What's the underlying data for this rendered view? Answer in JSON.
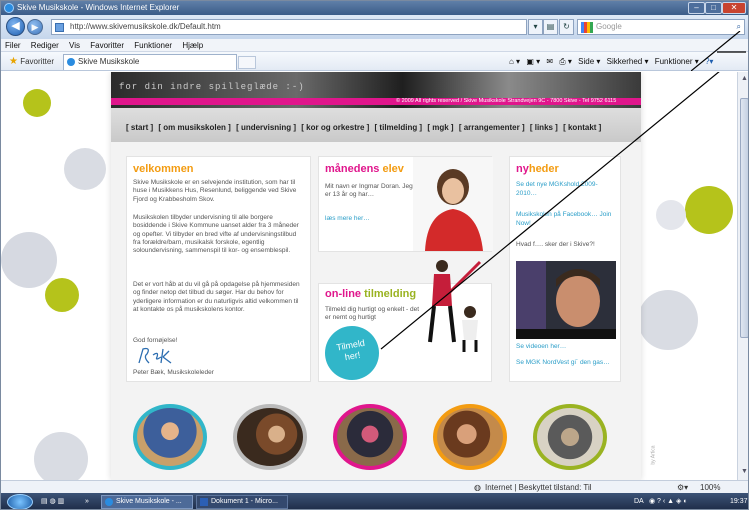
{
  "window": {
    "title": "Skive Musikskole - Windows Internet Explorer",
    "min": "–",
    "max": "□",
    "close": "✕"
  },
  "address": {
    "url": "http://www.skivemusikskole.dk/Default.htm",
    "search_placeholder": "Google",
    "search_symbol": "⌕"
  },
  "menu": [
    "Filer",
    "Rediger",
    "Vis",
    "Favoritter",
    "Funktioner",
    "Hjælp"
  ],
  "favorites": {
    "label": "Favoritter",
    "tab_title": "Skive Musikskole",
    "commands": [
      "Side ▾",
      "Sikkerhed ▾",
      "Funktioner ▾"
    ]
  },
  "site": {
    "tagline": "for din indre spilleglæde :-)",
    "copyright": "© 2009 All rights reserved / Skive Musikskole Strandvejen 9C - 7800 Skive - Tel 9752 6115",
    "nav": [
      "[ start ]",
      "[ om musikskolen ]",
      "[ undervisning ]",
      "[ kor og orkestre ]",
      "[ tilmelding ]",
      "[ mgk ]",
      "[ arrangementer ]",
      "[ links ]",
      "[ kontakt ]"
    ],
    "velkommen": {
      "title": "velkommen",
      "p1": "Skive Musikskole er en selvejende institution, som har til huse i Musikkens Hus, Resenlund, beliggende ved Skive Fjord og Krabbesholm Skov.",
      "p2": "Musikskolen tilbyder undervisning til alle borgere bosiddende i Skive Kommune uanset alder fra 3 måneder og opefter. Vi tilbyder en bred vifte af undervisningstilbud fra forældre/barn, musikalsk forskole, egentlig soloundervisning, sammenspil til kor- og ensemblespil.",
      "p3": "Det er vort håb at du vil gå på opdagelse på hjemmesiden og finder netop det tilbud du søger. Har du behov for yderligere information er du naturligvis altid velkommen til at kontakte os på musikskolens kontor.",
      "greeting": "God fornøjelse!",
      "signature": "Peter Bæk, Musikskoleleder"
    },
    "maanedens": {
      "title_a": "månedens",
      "title_b": "elev",
      "text": "Mit navn er Ingmar Doran. Jeg er 13 år og har…",
      "link": "læs mere her…"
    },
    "online": {
      "title_a": "on-line",
      "title_b": "tilmelding",
      "text": "Tilmeld dig hurtigt og enkelt - det er nemt og hurtigt",
      "bubble_a": "Tilmeld",
      "bubble_b": "her!"
    },
    "nyheder": {
      "title_a": "ny",
      "title_b": "heder",
      "link1": "Se det nye MGKshold 2009-2010…",
      "link2": "Musikskolen på Facebook… Join Now!",
      "question": "Hvad f…. sker der i Skive?!",
      "link3": "Se videoen her…",
      "link4": "Se MGK NordVest gi´ den gas…"
    },
    "side_mark": "by Artica"
  },
  "status": {
    "zone": "Internet | Beskyttet tilstand: Til",
    "zoom": "100%"
  },
  "taskbar": {
    "items": [
      "Skive Musikskole - ...",
      "Dokument 1 - Micro..."
    ],
    "lang": "DA",
    "clock": "19:37"
  },
  "colors": {
    "pink": "#e0168c",
    "orange": "#f39c12",
    "green": "#9ab321",
    "blue": "#2b9ec8",
    "teal": "#31b6c9"
  }
}
